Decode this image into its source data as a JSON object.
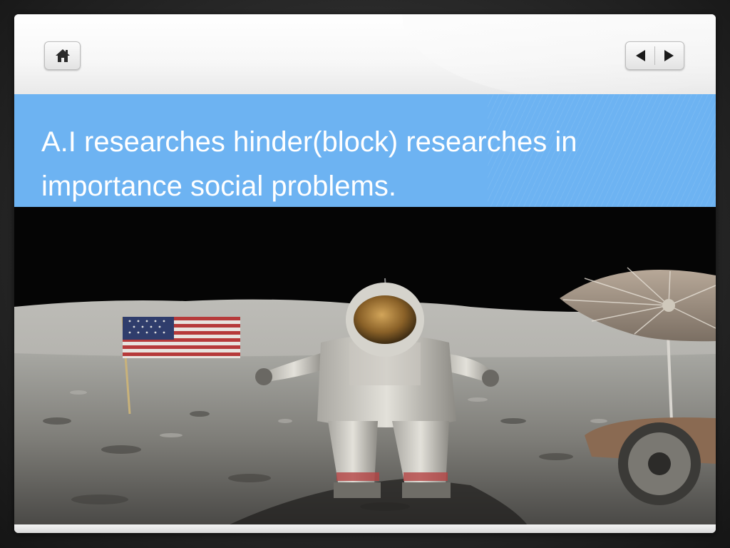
{
  "slide": {
    "title": "A.I researches hinder(block) researches in importance social problems."
  },
  "navigation": {
    "home_icon": "home-icon",
    "prev_icon": "triangle-left-icon",
    "next_icon": "triangle-right-icon"
  },
  "colors": {
    "title_band": "#6db3f2",
    "title_text": "#ffffff",
    "background": "#2a2a2a"
  }
}
